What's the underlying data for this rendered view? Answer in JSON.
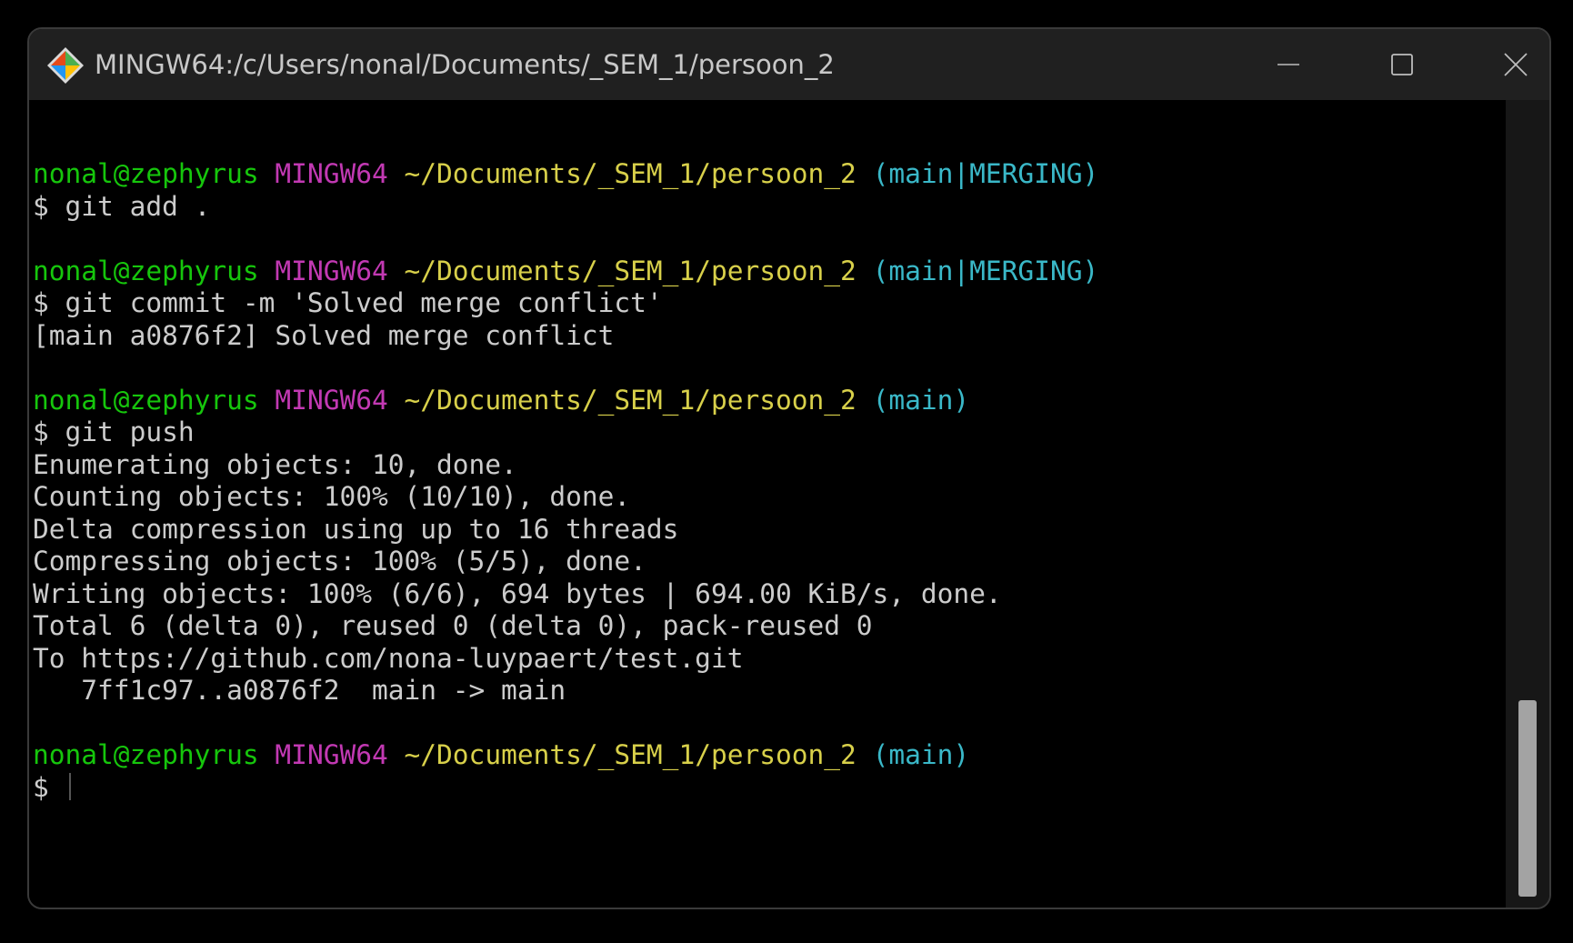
{
  "window": {
    "title": "MINGW64:/c/Users/nonal/Documents/_SEM_1/persoon_2"
  },
  "icons": {
    "app": "git-bash-diamond-icon",
    "minimize": "minimize-icon",
    "maximize": "maximize-icon",
    "close": "close-icon"
  },
  "colors": {
    "user_host": "#16c60c",
    "shell": "#c239b3",
    "path": "#d8d04a",
    "branch": "#3ab8c8",
    "output": "#cccccc"
  },
  "terminal": {
    "blocks": [
      {
        "prompt": {
          "user_host": "nonal@zephyrus",
          "shell": "MINGW64",
          "path": "~/Documents/_SEM_1/persoon_2",
          "branch": "(main|MERGING)"
        },
        "command": "$ git add .",
        "output": []
      },
      {
        "prompt": {
          "user_host": "nonal@zephyrus",
          "shell": "MINGW64",
          "path": "~/Documents/_SEM_1/persoon_2",
          "branch": "(main|MERGING)"
        },
        "command": "$ git commit -m 'Solved merge conflict'",
        "output": [
          "[main a0876f2] Solved merge conflict"
        ]
      },
      {
        "prompt": {
          "user_host": "nonal@zephyrus",
          "shell": "MINGW64",
          "path": "~/Documents/_SEM_1/persoon_2",
          "branch": "(main)"
        },
        "command": "$ git push",
        "output": [
          "Enumerating objects: 10, done.",
          "Counting objects: 100% (10/10), done.",
          "Delta compression using up to 16 threads",
          "Compressing objects: 100% (5/5), done.",
          "Writing objects: 100% (6/6), 694 bytes | 694.00 KiB/s, done.",
          "Total 6 (delta 0), reused 0 (delta 0), pack-reused 0",
          "To https://github.com/nona-luypaert/test.git",
          "   7ff1c97..a0876f2  main -> main"
        ]
      },
      {
        "prompt": {
          "user_host": "nonal@zephyrus",
          "shell": "MINGW64",
          "path": "~/Documents/_SEM_1/persoon_2",
          "branch": "(main)"
        },
        "command": "$ ",
        "output": []
      }
    ]
  }
}
